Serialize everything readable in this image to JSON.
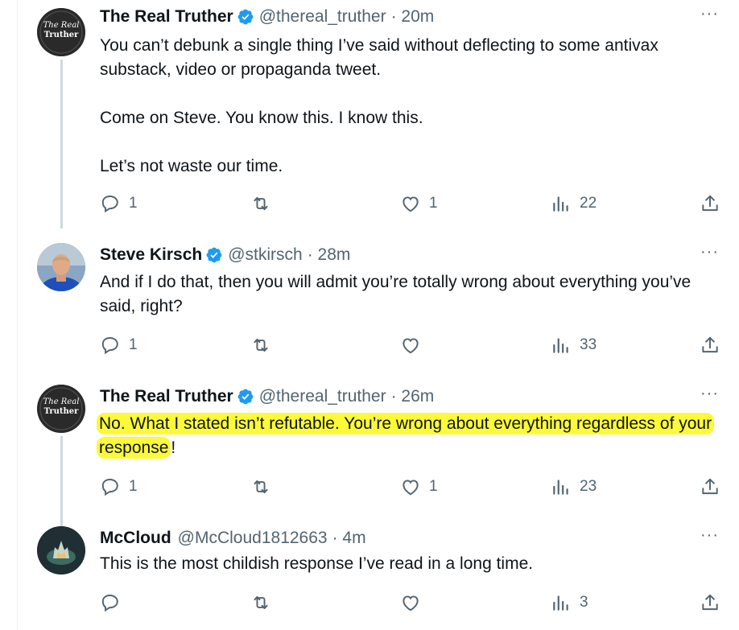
{
  "tweets": [
    {
      "name": "The Real Truther",
      "verified": true,
      "handle": "@thereal_truther",
      "time": "· 20m",
      "avatar_text": [
        "The Real",
        "Truther"
      ],
      "text": "You can’t debunk a single thing I’ve said without deflecting to some antivax substack, video or propaganda tweet.\n\nCome on Steve. You know this. I know this.\n\nLet’s not waste our time.",
      "replies": "1",
      "retweets": "",
      "likes": "1",
      "views": "22"
    },
    {
      "name": "Steve Kirsch",
      "verified": true,
      "handle": "@stkirsch",
      "time": "· 28m",
      "text": "And if I do that, then you will admit you’re totally wrong about everything you’ve said, right?",
      "replies": "1",
      "retweets": "",
      "likes": "",
      "views": "33"
    },
    {
      "name": "The Real Truther",
      "verified": true,
      "handle": "@thereal_truther",
      "time": "· 26m",
      "avatar_text": [
        "The Real",
        "Truther"
      ],
      "text_highlighted": "No. What I stated isn’t refutable. You’re wrong about everything regardless of your response",
      "text_tail": "!",
      "highlight_color": "#fbf93a",
      "replies": "1",
      "retweets": "",
      "likes": "1",
      "views": "23"
    },
    {
      "name": "McCloud",
      "verified": false,
      "handle": "@McCloud1812663",
      "time": "· 4m",
      "text": "This is the most childish response I’ve read in a long time.",
      "replies": "",
      "retweets": "",
      "likes": "",
      "views": "3"
    }
  ],
  "more_label": "···",
  "colors": {
    "verified": "#1d9bf0",
    "secondary_text": "#536471",
    "thread_line": "#cfd9de"
  }
}
